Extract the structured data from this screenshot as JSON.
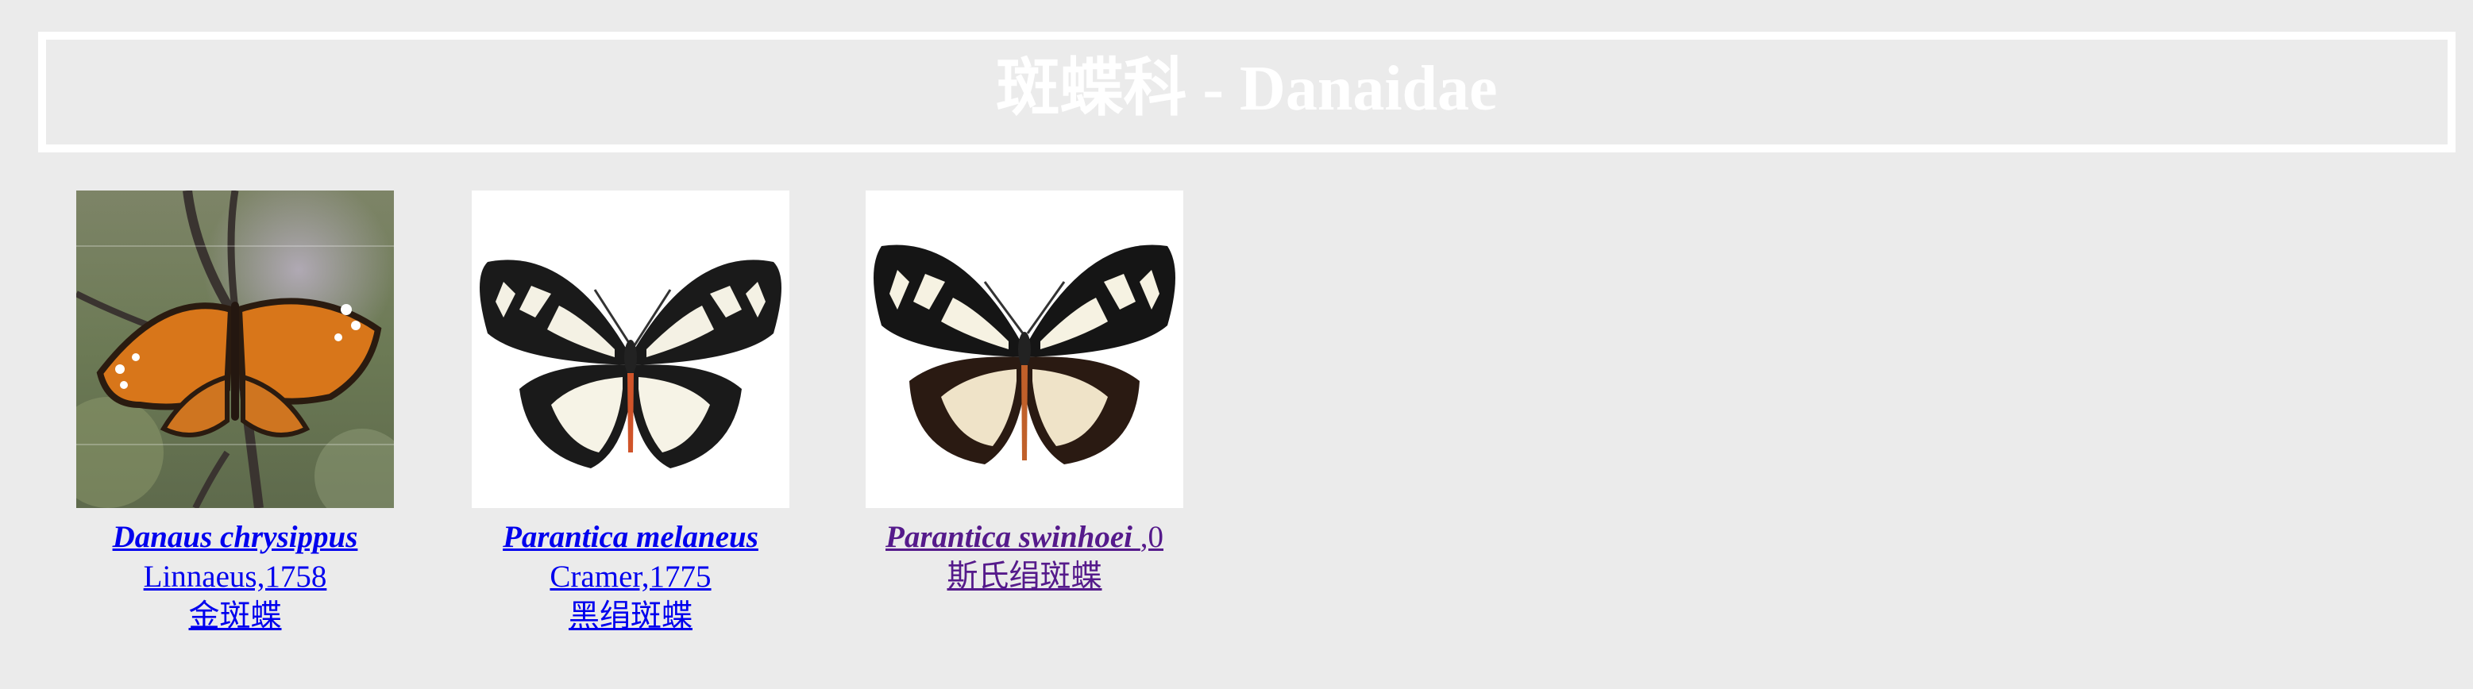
{
  "header": {
    "title": "斑蝶科 - Danaidae"
  },
  "colors": {
    "background": "#ebebeb",
    "link": "#0000ee",
    "visited": "#551a8b",
    "title": "#ffffff"
  },
  "species": [
    {
      "scientific_name": "Danaus chrysippus",
      "author": "Linnaeus,1758",
      "common_name": "金斑蝶",
      "image_icon": "butterfly-orange-photo"
    },
    {
      "scientific_name": "Parantica melaneus",
      "author": "Cramer,1775",
      "common_name": "黑绢斑蝶",
      "image_icon": "butterfly-black-white-specimen"
    },
    {
      "scientific_name": "Parantica swinhoei ",
      "author": ",0",
      "common_name": "斯氏绢斑蝶",
      "image_icon": "butterfly-black-white-specimen"
    }
  ]
}
